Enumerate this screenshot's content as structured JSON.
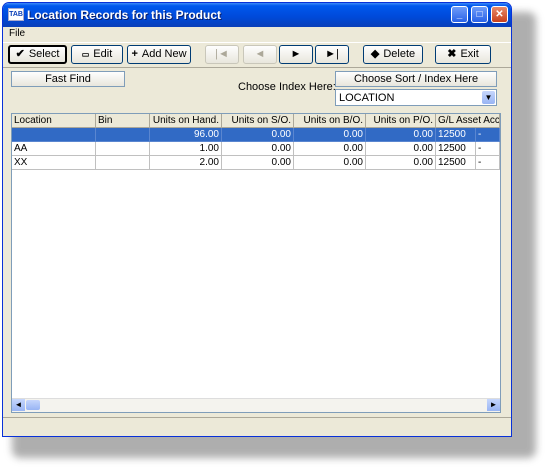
{
  "window": {
    "title": "Location Records for this Product",
    "icon_text": "TAB"
  },
  "menu": {
    "file": "File"
  },
  "toolbar": {
    "select": "Select",
    "edit": "Edit",
    "add_new": "Add New",
    "first": "|◄",
    "prev": "◄",
    "next": "►",
    "last": "►|",
    "delete": "Delete",
    "exit": "Exit"
  },
  "search": {
    "fast_find": "Fast Find",
    "index_label": "Choose Index Here:",
    "sort_button": "Choose Sort / Index Here",
    "index_value": "LOCATION"
  },
  "grid": {
    "columns": [
      "Location",
      "Bin",
      "Units on Hand.",
      "Units on S/O.",
      "Units on B/O.",
      "Units on P/O.",
      "G/L Asset Acct+Dept"
    ],
    "rows": [
      [
        "",
        "",
        "96.00",
        "0.00",
        "0.00",
        "0.00",
        "12500",
        "-"
      ],
      [
        "AA",
        "",
        "1.00",
        "0.00",
        "0.00",
        "0.00",
        "12500",
        "-"
      ],
      [
        "XX",
        "",
        "2.00",
        "0.00",
        "0.00",
        "0.00",
        "12500",
        "-"
      ]
    ],
    "selected_row": 0
  }
}
